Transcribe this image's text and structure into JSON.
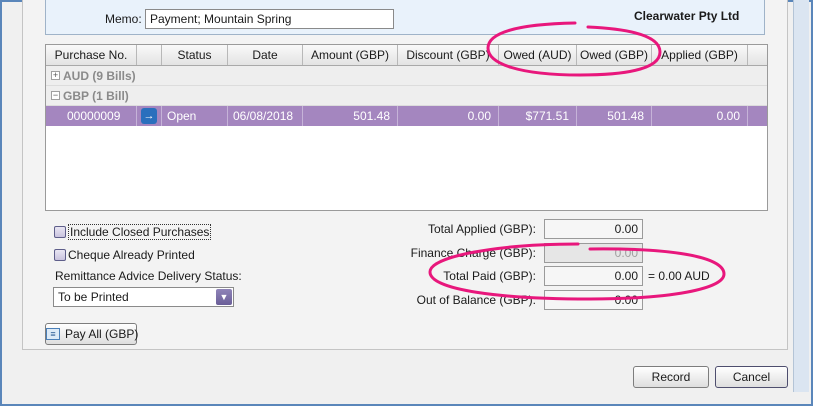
{
  "header": {
    "memo_label": "Memo:",
    "memo_value": "Payment; Mountain Spring",
    "company_name": "Clearwater Pty Ltd"
  },
  "grid": {
    "columns": [
      "Purchase No.",
      "",
      "Status",
      "Date",
      "Amount (GBP)",
      "Discount (GBP)",
      "Owed (AUD)",
      "Owed (GBP)",
      "Applied (GBP)"
    ],
    "groups": [
      {
        "expander": "+",
        "label": "AUD (9 Bills)"
      },
      {
        "expander": "−",
        "label": "GBP (1 Bill)"
      }
    ],
    "rows": [
      {
        "purchase_no": "00000009",
        "status": "Open",
        "date": "06/08/2018",
        "amount": "501.48",
        "discount": "0.00",
        "owed_aud": "$771.51",
        "owed_gbp": "501.48",
        "applied": "0.00"
      }
    ]
  },
  "options": {
    "include_closed": "Include Closed Purchases",
    "cheque_printed": "Cheque Already Printed",
    "remittance_label": "Remittance Advice Delivery Status:",
    "remittance_value": "To be Printed"
  },
  "totals": {
    "applied_label": "Total Applied (GBP):",
    "applied_value": "0.00",
    "finance_label": "Finance Charge (GBP):",
    "finance_value": "0.00",
    "paid_label": "Total Paid (GBP):",
    "paid_value": "0.00",
    "paid_aud": "= 0.00 AUD",
    "balance_label": "Out of Balance (GBP):",
    "balance_value": "0.00"
  },
  "buttons": {
    "pay_all": "Pay All (GBP)",
    "record": "Record",
    "cancel": "Cancel"
  },
  "icons": {
    "go_arrow": "→",
    "dropdown": "▼",
    "pay_all": "≡"
  },
  "colors": {
    "selected_row": "#a486bf",
    "annotation": "#e8177c"
  }
}
